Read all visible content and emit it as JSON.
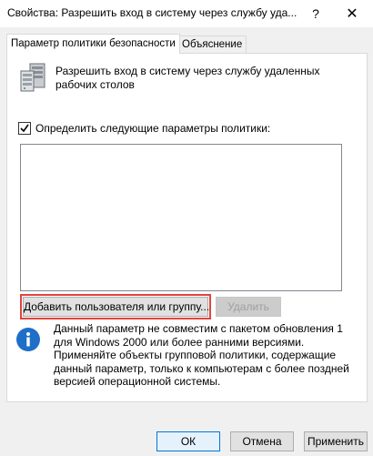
{
  "window": {
    "title": "Свойства: Разрешить вход в систему через службу уда...",
    "help_label": "?",
    "close_label": "✕"
  },
  "tabs": [
    {
      "label": "Параметр политики безопасности"
    },
    {
      "label": "Объяснение"
    }
  ],
  "policy": {
    "icon": "server-policy-icon",
    "name": "Разрешить вход в систему через службу удаленных рабочих столов"
  },
  "define_checkbox": {
    "label": "Определить следующие параметры политики:",
    "checked": true
  },
  "users_list": [],
  "buttons": {
    "add": "Добавить пользователя или группу...",
    "remove": "Удалить",
    "ok": "ОК",
    "cancel": "Отмена",
    "apply": "Применить"
  },
  "info": {
    "icon": "info-icon",
    "text": "Данный параметр не совместим с пакетом обновления 1 для Windows 2000 или более ранними версиями. Применяйте объекты групповой политики, содержащие данный параметр, только к компьютерам с более поздней версией операционной системы."
  },
  "colors": {
    "highlight_border": "#e0443d",
    "info_blue": "#1e6fc7",
    "ok_border": "#0078d7"
  }
}
